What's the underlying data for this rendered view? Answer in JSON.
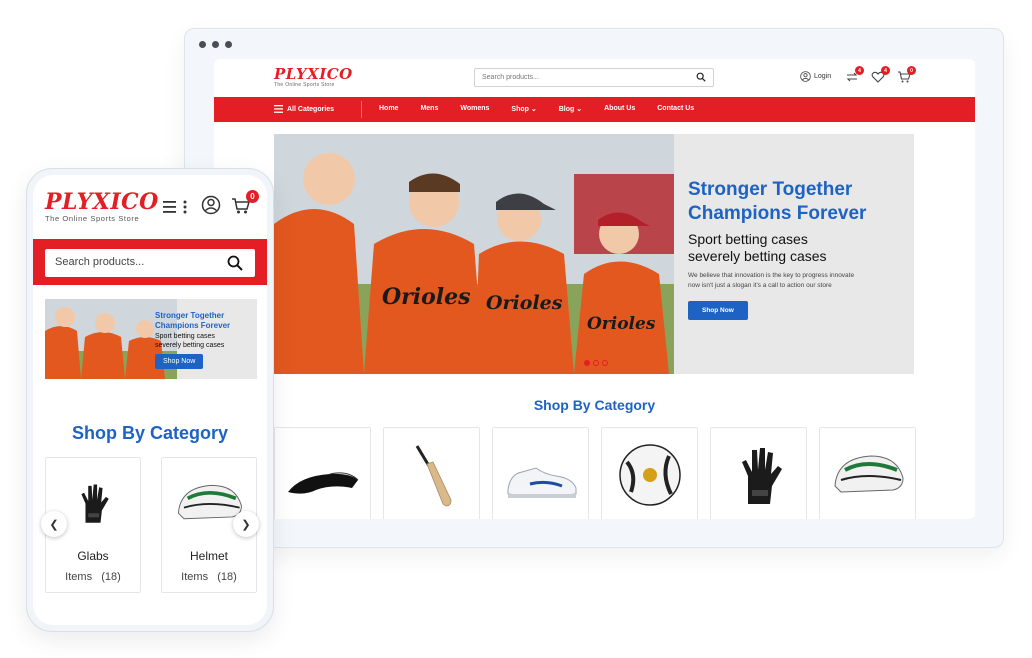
{
  "brand": {
    "name": "PLYXICO",
    "tagline": "The Online Sports Store",
    "primary_color": "#e31e24",
    "accent_color": "#1e63c4"
  },
  "desktop": {
    "search_placeholder": "Search products...",
    "login_label": "Login",
    "compare_count": "4",
    "wishlist_count": "4",
    "cart_count": "0",
    "nav": {
      "all_categories": "All Categories",
      "items": [
        "Home",
        "Mens",
        "Womens",
        "Shop",
        "Blog",
        "About Us",
        "Contact Us"
      ]
    },
    "hero": {
      "title_line1": "Stronger Together",
      "title_line2": "Champions Forever",
      "subtitle_line1": "Sport betting cases",
      "subtitle_line2": "severely betting cases",
      "description_line1": "We believe that innovation is the key to progress innovate",
      "description_line2": "now isn't just a slogan it's a call to action our store",
      "button": "Shop Now",
      "jersey_text": "Orioles",
      "slide_count": 3,
      "active_slide": 1
    },
    "category_title": "Shop By Category",
    "categories": [
      {
        "icon": "visor-cap-icon"
      },
      {
        "icon": "cricket-bat-icon"
      },
      {
        "icon": "sneaker-icon"
      },
      {
        "icon": "soccer-ball-icon"
      },
      {
        "icon": "batting-glove-icon"
      },
      {
        "icon": "helmet-icon"
      }
    ]
  },
  "mobile": {
    "search_placeholder": "Search products...",
    "cart_count": "0",
    "banner": {
      "title_line1": "Stronger Together",
      "title_line2": "Champions Forever",
      "subtitle_line1": "Sport betting cases",
      "subtitle_line2": "severely betting cases",
      "button": "Shop Now"
    },
    "category_title": "Shop By Category",
    "categories": [
      {
        "label": "Glabs",
        "items_label": "Items",
        "count": "(18)"
      },
      {
        "label": "Helmet",
        "items_label": "Items",
        "count": "(18)"
      }
    ]
  }
}
